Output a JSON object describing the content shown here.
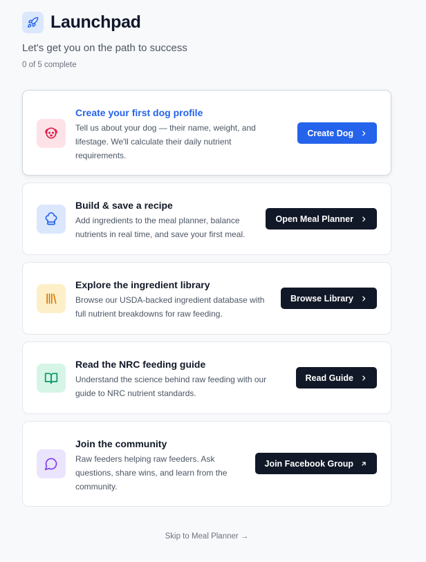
{
  "header": {
    "logo_icon": "rocket-icon",
    "title": "Launchpad",
    "subtitle": "Let's get you on the path to success",
    "progress": "0 of 5 complete"
  },
  "steps": [
    {
      "icon": "dog-icon",
      "icon_color": "#e11d48",
      "icon_bg": "#fde2e7",
      "title": "Create your first dog profile",
      "desc_lines": [
        "Tell us about your dog — their name, weight, and",
        "lifestage. We'll calculate their daily nutrient",
        "requirements."
      ],
      "button": "Create Dog",
      "button_icon": "chevron-right-icon"
    },
    {
      "icon": "chef-hat-icon",
      "icon_color": "#2563eb",
      "icon_bg": "#dbe7fd",
      "title": "Build & save a recipe",
      "desc_lines": [
        "Add ingredients to the meal planner, balance",
        "nutrients in real time, and save your first meal."
      ],
      "button": "Open Meal Planner",
      "button_icon": "chevron-right-icon"
    },
    {
      "icon": "library-icon",
      "icon_color": "#d97706",
      "icon_bg": "#fdf0c8",
      "title": "Explore the ingredient library",
      "desc_lines": [
        "Browse our USDA-backed ingredient database with",
        "full nutrient breakdowns for raw feeding."
      ],
      "button": "Browse Library",
      "button_icon": "chevron-right-icon"
    },
    {
      "icon": "book-open-icon",
      "icon_color": "#059669",
      "icon_bg": "#d6f5e6",
      "title": "Read the NRC feeding guide",
      "desc_lines": [
        "Understand the science behind raw feeding with our",
        "guide to NRC nutrient standards."
      ],
      "button": "Read Guide",
      "button_icon": "chevron-right-icon"
    },
    {
      "icon": "message-circle-icon",
      "icon_color": "#7c3aed",
      "icon_bg": "#ebe4fd",
      "title": "Join the community",
      "desc_lines": [
        "Raw feeders helping raw feeders. Ask",
        "questions, share wins, and learn from the",
        "community."
      ],
      "button": "Join Facebook Group",
      "button_icon": "external-arrow-icon"
    }
  ],
  "skip_link": "Skip to Meal Planner →"
}
